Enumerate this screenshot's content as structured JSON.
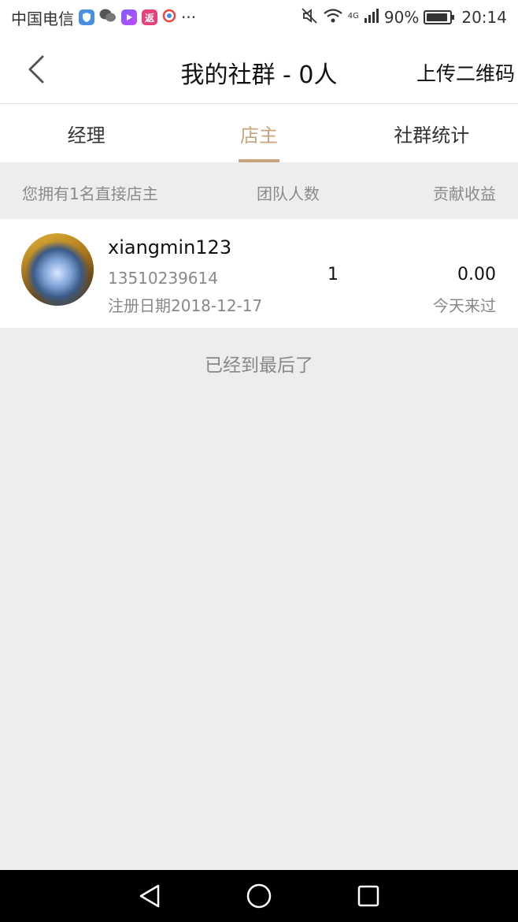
{
  "status_bar": {
    "carrier": "中国电信",
    "fanli_app_label": "返",
    "more": "···",
    "network": "4G",
    "battery": "90%",
    "time": "20:14"
  },
  "header": {
    "title": "我的社群 - 0人",
    "upload_qr_label": "上传二维码"
  },
  "tabs": [
    {
      "label": "经理",
      "active": false
    },
    {
      "label": "店主",
      "active": true
    },
    {
      "label": "社群统计",
      "active": false
    }
  ],
  "columns": {
    "summary": "您拥有1名直接店主",
    "team_count": "团队人数",
    "contribution": "贡献收益"
  },
  "members": [
    {
      "name": "xiangmin123",
      "phone": "13510239614",
      "register_date": "注册日期2018-12-17",
      "team_count": "1",
      "earning": "0.00",
      "last_visit": "今天来过"
    }
  ],
  "end_text": "已经到最后了",
  "colors": {
    "accent": "#c9a57f",
    "background": "#ededed",
    "nav_bar": "#000000"
  }
}
